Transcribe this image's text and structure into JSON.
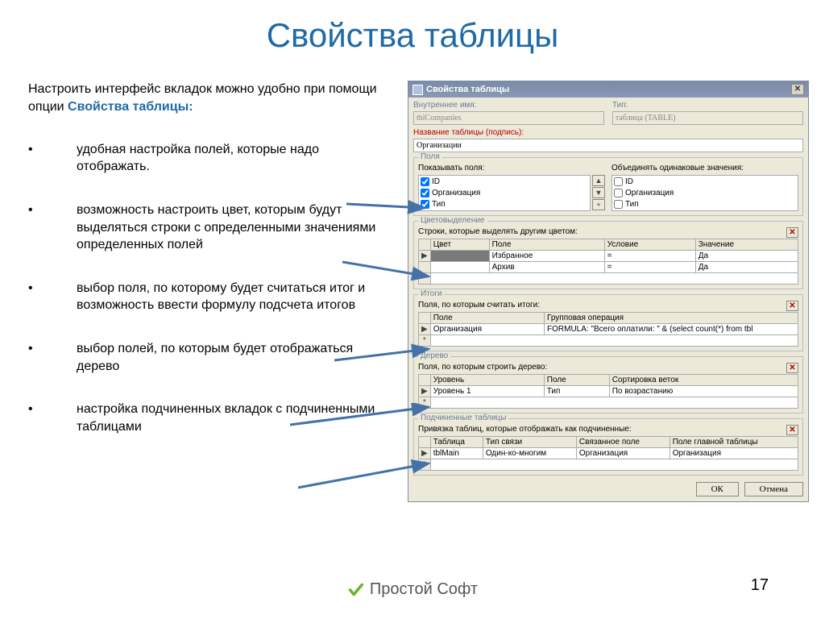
{
  "slide": {
    "title": "Свойства таблицы",
    "intro_1": "Настроить интерфейс вкладок можно удобно при помощи опции ",
    "intro_highlight": "Свойства таблицы:",
    "bullets": [
      "удобная настройка полей, которые надо отображать.",
      "возможность настроить цвет, которым будут выделяться строки с определенными значениями определенных полей",
      "выбор поля, по которому будет считаться итог и возможность ввести формулу подсчета итогов",
      "выбор полей, по которым будет отображаться дерево",
      "настройка подчиненных вкладок с подчиненными таблицами"
    ],
    "page_number": "17",
    "logo_text": "Простой Софт"
  },
  "dialog": {
    "title": "Свойства таблицы",
    "labels": {
      "internal_name": "Внутреннее имя:",
      "type": "Тип:",
      "table_caption": "Название таблицы (подпись):"
    },
    "internal_name_value": "tblCompanies",
    "type_value": "таблица (TABLE)",
    "caption_value": "Организации",
    "groups": {
      "fields": {
        "title": "Поля",
        "show_label": "Показывать поля:",
        "merge_label": "Объединять одинаковые значения:",
        "show_items": [
          "ID",
          "Организация",
          "Тип"
        ],
        "merge_items": [
          "ID",
          "Организация",
          "Тип"
        ]
      },
      "color": {
        "title": "Цветовыделение",
        "sub": "Строки, которые выделять другим цветом:",
        "cols": [
          "Цвет",
          "Поле",
          "Условие",
          "Значение"
        ],
        "rows": [
          [
            "",
            "Избранное",
            "=",
            "Да"
          ],
          [
            "",
            "Архив",
            "=",
            "Да"
          ]
        ]
      },
      "totals": {
        "title": "Итоги",
        "sub": "Поля, по которым считать итоги:",
        "cols": [
          "Поле",
          "Групповая операция"
        ],
        "rows": [
          [
            "Организация",
            "FORMULA: \"Всего оплатили: \" & (select count(*) from tbl"
          ]
        ]
      },
      "tree": {
        "title": "Дерево",
        "sub": "Поля, по которым строить дерево:",
        "cols": [
          "Уровень",
          "Поле",
          "Сортировка веток"
        ],
        "rows": [
          [
            "Уровень 1",
            "Тип",
            "По возрастанию"
          ]
        ]
      },
      "subtables": {
        "title": "Подчиненные таблицы",
        "sub": "Привязка таблиц, которые отображать как подчиненные:",
        "cols": [
          "Таблица",
          "Тип связи",
          "Связанное поле",
          "Поле главной таблицы"
        ],
        "rows": [
          [
            "tblMain",
            "Один-ко-многим",
            "Организация",
            "Организация"
          ]
        ]
      }
    },
    "buttons": {
      "ok": "ОК",
      "cancel": "Отмена"
    }
  }
}
